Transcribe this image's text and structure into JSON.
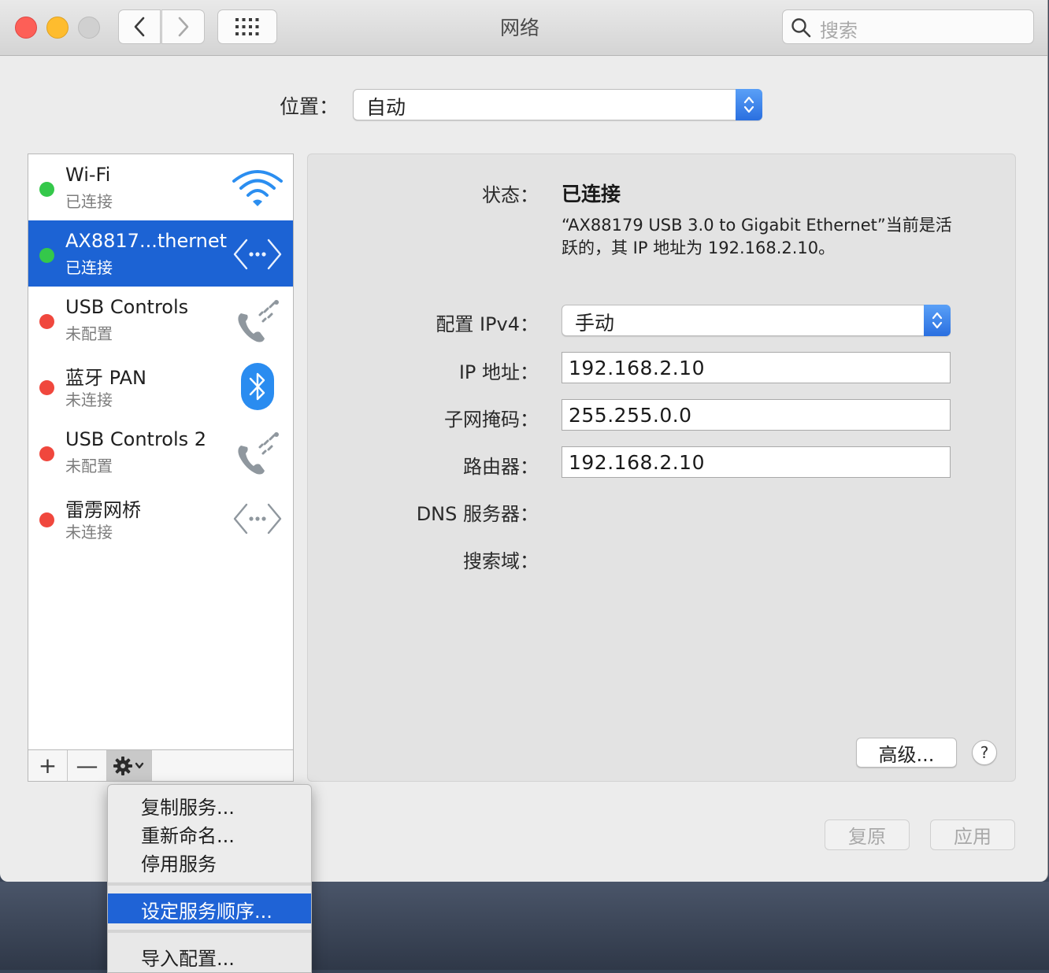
{
  "window": {
    "title": "网络",
    "search_placeholder": "搜索"
  },
  "location": {
    "label": "位置：",
    "value": "自动"
  },
  "services": [
    {
      "name": "Wi-Fi",
      "status": "已连接",
      "state": "connected",
      "icon": "wifi-icon",
      "selected": false
    },
    {
      "name": "AX8817...thernet",
      "status": "已连接",
      "state": "connected",
      "icon": "ethernet-icon",
      "selected": true
    },
    {
      "name": "USB Controls",
      "status": "未配置",
      "state": "not-configured",
      "icon": "phone-icon",
      "selected": false
    },
    {
      "name": "蓝牙 PAN",
      "status": "未连接",
      "state": "disconnected",
      "icon": "bluetooth-icon",
      "selected": false
    },
    {
      "name": "USB Controls 2",
      "status": "未配置",
      "state": "not-configured",
      "icon": "phone-icon",
      "selected": false
    },
    {
      "name": "雷雳网桥",
      "status": "未连接",
      "state": "disconnected",
      "icon": "ethernet-icon",
      "selected": false
    }
  ],
  "list_toolbar": {
    "add": "+",
    "remove": "—"
  },
  "detail": {
    "status_label": "状态：",
    "status_value": "已连接",
    "status_desc": "“AX88179 USB 3.0 to Gigabit Ethernet”当前是活跃的，其 IP 地址为 192.168.2.10。",
    "configure_label": "配置 IPv4：",
    "configure_value": "手动",
    "ip_label": "IP 地址：",
    "ip_value": "192.168.2.10",
    "subnet_label": "子网掩码：",
    "subnet_value": "255.255.0.0",
    "router_label": "路由器：",
    "router_value": "192.168.2.10",
    "dns_label": "DNS 服务器：",
    "search_domain_label": "搜索域：",
    "advanced_button": "高级...",
    "help_button": "?"
  },
  "footer": {
    "revert_button": "复原",
    "apply_button": "应用"
  },
  "gear_menu": {
    "items": [
      "复制服务...",
      "重新命名...",
      "停用服务",
      "设定服务顺序...",
      "导入配置..."
    ],
    "highlighted": "设定服务顺序..."
  },
  "colors": {
    "connected": "#34c84a",
    "not_connected": "#f0473d",
    "selection": "#1c63d4",
    "menu_highlight": "#1f63d6"
  }
}
